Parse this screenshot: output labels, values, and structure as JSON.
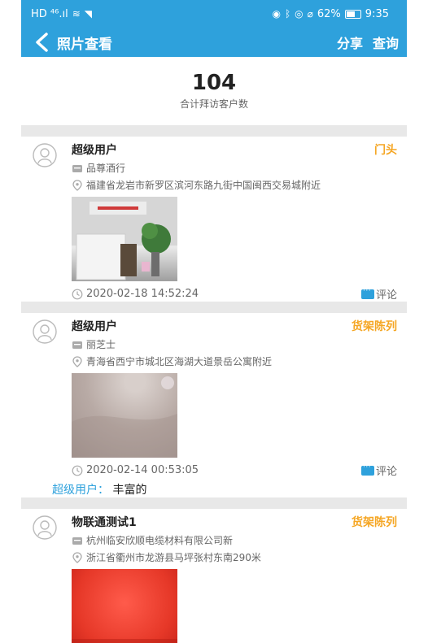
{
  "status_bar": {
    "left_text": "HD ⁴⁶.ıl",
    "battery": "62%",
    "time": "9:35"
  },
  "nav": {
    "title": "照片查看",
    "share_label": "分享",
    "query_label": "查询"
  },
  "summary": {
    "count": "104",
    "label": "合计拜访客户数"
  },
  "cards": [
    {
      "user": "超级用户",
      "tag": "门头",
      "shop": "品尊酒行",
      "address": "福建省龙岩市新罗区滨河东路九街中国闽西交易城附近",
      "time": "2020-02-18 14:52:24",
      "comment_label": "评论"
    },
    {
      "user": "超级用户",
      "tag": "货架陈列",
      "shop": "丽芝士",
      "address": "青海省西宁市城北区海湖大道景岳公寓附近",
      "time": "2020-02-14 00:53:05",
      "comment_label": "评论",
      "reply_user": "超级用户：",
      "reply_text": "丰富的"
    },
    {
      "user": "物联通测试1",
      "tag": "货架陈列",
      "shop": "杭州临安欣顺电缆材料有限公司新",
      "address": "浙江省衢州市龙游县马坪张村东南290米"
    }
  ],
  "colors": {
    "accent": "#2ea1dc",
    "tag": "#f5a623",
    "gap": "#e8e8e8"
  }
}
